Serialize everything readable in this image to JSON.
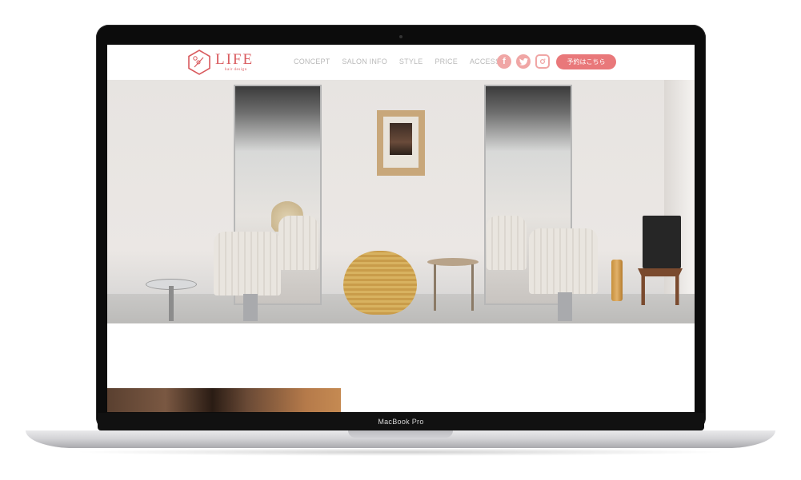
{
  "device": {
    "label": "MacBook Pro"
  },
  "site": {
    "logo": {
      "title": "LIFE",
      "subtitle": "hair design"
    },
    "nav": [
      {
        "label": "CONCEPT"
      },
      {
        "label": "SALON INFO"
      },
      {
        "label": "STYLE"
      },
      {
        "label": "PRICE"
      },
      {
        "label": "ACCESS"
      }
    ],
    "social": [
      {
        "icon": "facebook-icon",
        "glyph": "f"
      },
      {
        "icon": "twitter-icon",
        "glyph": "t"
      },
      {
        "icon": "instagram-icon",
        "glyph": "◎"
      }
    ],
    "reserve_button": "予約はこちら",
    "colors": {
      "accent": "#e9787a",
      "brand": "#d95a5e",
      "nav_text": "#b9b9b9"
    }
  }
}
